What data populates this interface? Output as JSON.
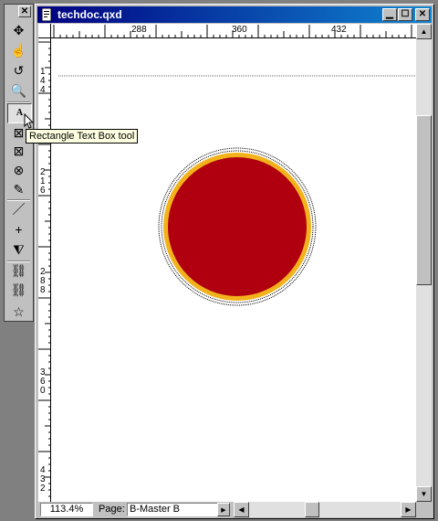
{
  "window": {
    "title": "techdoc.qxd"
  },
  "ruler": {
    "h_labels": [
      "288",
      "360",
      "432"
    ],
    "v_labels": [
      [
        "1",
        "4",
        "4"
      ],
      [
        "2",
        "1",
        "6"
      ],
      [
        "2",
        "8",
        "8"
      ],
      [
        "3",
        "6",
        "0"
      ],
      [
        "4",
        "3",
        "2"
      ]
    ]
  },
  "tooltip": {
    "text": "Rectangle Text Box tool"
  },
  "tools": [
    {
      "name": "item-tool",
      "glyph": "✥"
    },
    {
      "name": "content-tool",
      "glyph": "☝"
    },
    {
      "name": "rotation-tool",
      "glyph": "↺"
    },
    {
      "name": "zoom-tool",
      "glyph": "🔍"
    },
    {
      "name": "rectangle-text-box-tool",
      "glyph": "A"
    },
    {
      "name": "rectangle-picture-box-tool",
      "glyph": "⊠"
    },
    {
      "name": "rounded-picture-box-tool",
      "glyph": "⊠"
    },
    {
      "name": "oval-picture-box-tool",
      "glyph": "⊗"
    },
    {
      "name": "bezier-picture-box-tool",
      "glyph": "✎"
    },
    {
      "name": "line-tool",
      "glyph": "／"
    },
    {
      "name": "orthogonal-line-tool",
      "glyph": "+"
    },
    {
      "name": "text-path-tool",
      "glyph": "⧨"
    },
    {
      "name": "linking-tool",
      "glyph": "⛓"
    },
    {
      "name": "unlinking-tool",
      "glyph": "⛓"
    },
    {
      "name": "starburst-tool",
      "glyph": "☆"
    }
  ],
  "status": {
    "zoom": "113.4%",
    "page_label": "Page:",
    "page_value": "B-Master B"
  },
  "colors": {
    "circle_fill": "#b00010",
    "circle_frame": "#f2b21c",
    "titlebar": "#000080"
  }
}
